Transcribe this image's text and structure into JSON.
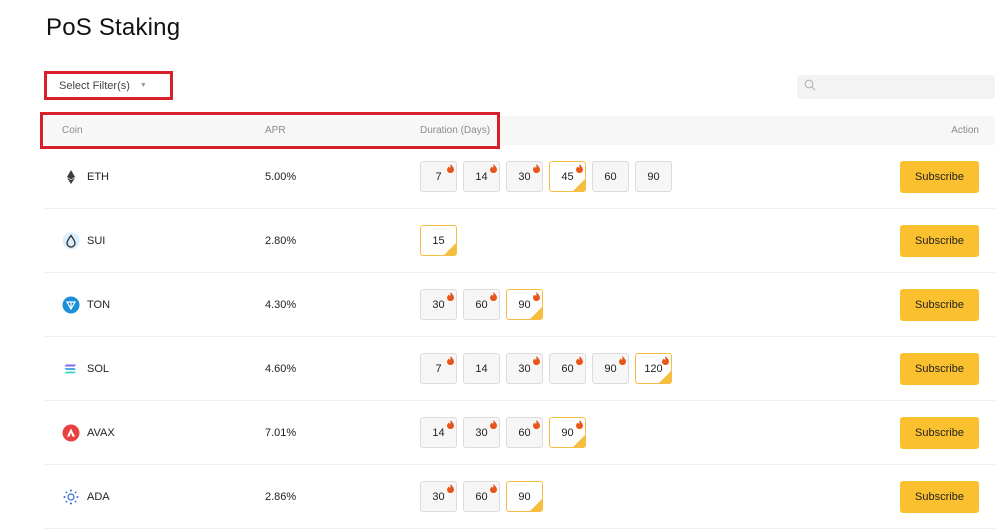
{
  "page_title": "PoS Staking",
  "filter": {
    "label": "Select Filter(s)"
  },
  "search": {
    "placeholder": ""
  },
  "table": {
    "headers": {
      "coin": "Coin",
      "apr": "APR",
      "duration": "Duration (Days)",
      "action": "Action"
    },
    "rows": [
      {
        "coin": "ETH",
        "icon": "eth-icon",
        "apr": "5.00%",
        "durations": [
          {
            "days": "7",
            "hot": true,
            "selected": false
          },
          {
            "days": "14",
            "hot": true,
            "selected": false
          },
          {
            "days": "30",
            "hot": true,
            "selected": false
          },
          {
            "days": "45",
            "hot": true,
            "selected": true
          },
          {
            "days": "60",
            "hot": false,
            "selected": false
          },
          {
            "days": "90",
            "hot": false,
            "selected": false
          }
        ],
        "action": "Subscribe"
      },
      {
        "coin": "SUI",
        "icon": "sui-icon",
        "apr": "2.80%",
        "durations": [
          {
            "days": "15",
            "hot": false,
            "selected": true
          }
        ],
        "action": "Subscribe"
      },
      {
        "coin": "TON",
        "icon": "ton-icon",
        "apr": "4.30%",
        "durations": [
          {
            "days": "30",
            "hot": true,
            "selected": false
          },
          {
            "days": "60",
            "hot": true,
            "selected": false
          },
          {
            "days": "90",
            "hot": true,
            "selected": true
          }
        ],
        "action": "Subscribe"
      },
      {
        "coin": "SOL",
        "icon": "sol-icon",
        "apr": "4.60%",
        "durations": [
          {
            "days": "7",
            "hot": true,
            "selected": false
          },
          {
            "days": "14",
            "hot": false,
            "selected": false
          },
          {
            "days": "30",
            "hot": true,
            "selected": false
          },
          {
            "days": "60",
            "hot": true,
            "selected": false
          },
          {
            "days": "90",
            "hot": true,
            "selected": false
          },
          {
            "days": "120",
            "hot": true,
            "selected": true
          }
        ],
        "action": "Subscribe"
      },
      {
        "coin": "AVAX",
        "icon": "avax-icon",
        "apr": "7.01%",
        "durations": [
          {
            "days": "14",
            "hot": true,
            "selected": false
          },
          {
            "days": "30",
            "hot": true,
            "selected": false
          },
          {
            "days": "60",
            "hot": true,
            "selected": false
          },
          {
            "days": "90",
            "hot": true,
            "selected": true
          }
        ],
        "action": "Subscribe"
      },
      {
        "coin": "ADA",
        "icon": "ada-icon",
        "apr": "2.86%",
        "durations": [
          {
            "days": "30",
            "hot": true,
            "selected": false
          },
          {
            "days": "60",
            "hot": true,
            "selected": false
          },
          {
            "days": "90",
            "hot": false,
            "selected": true
          }
        ],
        "action": "Subscribe"
      }
    ]
  },
  "colors": {
    "accent": "#fbc02d",
    "highlight": "#d8202a",
    "flame": "#e8551c",
    "selected_border": "#f6be41"
  }
}
